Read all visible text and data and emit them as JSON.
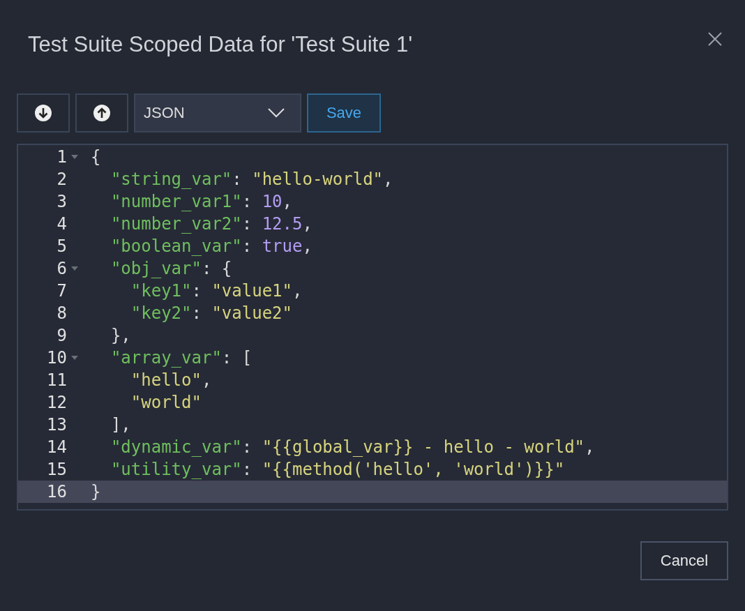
{
  "dialog": {
    "title": "Test Suite Scoped Data for 'Test Suite 1'"
  },
  "toolbar": {
    "format_select": {
      "value": "JSON"
    },
    "save_button": "Save"
  },
  "editor": {
    "lines": [
      {
        "number": "1",
        "foldable": true,
        "active": false,
        "tokens": [
          {
            "kind": "punct",
            "text": "{"
          }
        ]
      },
      {
        "number": "2",
        "foldable": false,
        "active": false,
        "tokens": [
          {
            "kind": "key",
            "text": "  \"string_var\""
          },
          {
            "kind": "punct",
            "text": ": "
          },
          {
            "kind": "string",
            "text": "\"hello-world\""
          },
          {
            "kind": "punct",
            "text": ","
          }
        ]
      },
      {
        "number": "3",
        "foldable": false,
        "active": false,
        "tokens": [
          {
            "kind": "key",
            "text": "  \"number_var1\""
          },
          {
            "kind": "punct",
            "text": ": "
          },
          {
            "kind": "number",
            "text": "10"
          },
          {
            "kind": "punct",
            "text": ","
          }
        ]
      },
      {
        "number": "4",
        "foldable": false,
        "active": false,
        "tokens": [
          {
            "kind": "key",
            "text": "  \"number_var2\""
          },
          {
            "kind": "punct",
            "text": ": "
          },
          {
            "kind": "number",
            "text": "12.5"
          },
          {
            "kind": "punct",
            "text": ","
          }
        ]
      },
      {
        "number": "5",
        "foldable": false,
        "active": false,
        "tokens": [
          {
            "kind": "key",
            "text": "  \"boolean_var\""
          },
          {
            "kind": "punct",
            "text": ": "
          },
          {
            "kind": "number",
            "text": "true"
          },
          {
            "kind": "punct",
            "text": ","
          }
        ]
      },
      {
        "number": "6",
        "foldable": true,
        "active": false,
        "tokens": [
          {
            "kind": "key",
            "text": "  \"obj_var\""
          },
          {
            "kind": "punct",
            "text": ": {"
          }
        ]
      },
      {
        "number": "7",
        "foldable": false,
        "active": false,
        "tokens": [
          {
            "kind": "key",
            "text": "    \"key1\""
          },
          {
            "kind": "punct",
            "text": ": "
          },
          {
            "kind": "string",
            "text": "\"value1\""
          },
          {
            "kind": "punct",
            "text": ","
          }
        ]
      },
      {
        "number": "8",
        "foldable": false,
        "active": false,
        "tokens": [
          {
            "kind": "key",
            "text": "    \"key2\""
          },
          {
            "kind": "punct",
            "text": ": "
          },
          {
            "kind": "string",
            "text": "\"value2\""
          }
        ]
      },
      {
        "number": "9",
        "foldable": false,
        "active": false,
        "tokens": [
          {
            "kind": "punct",
            "text": "  },"
          }
        ]
      },
      {
        "number": "10",
        "foldable": true,
        "active": false,
        "tokens": [
          {
            "kind": "key",
            "text": "  \"array_var\""
          },
          {
            "kind": "punct",
            "text": ": ["
          }
        ]
      },
      {
        "number": "11",
        "foldable": false,
        "active": false,
        "tokens": [
          {
            "kind": "string",
            "text": "    \"hello\""
          },
          {
            "kind": "punct",
            "text": ","
          }
        ]
      },
      {
        "number": "12",
        "foldable": false,
        "active": false,
        "tokens": [
          {
            "kind": "string",
            "text": "    \"world\""
          }
        ]
      },
      {
        "number": "13",
        "foldable": false,
        "active": false,
        "tokens": [
          {
            "kind": "punct",
            "text": "  ],"
          }
        ]
      },
      {
        "number": "14",
        "foldable": false,
        "active": false,
        "tokens": [
          {
            "kind": "key",
            "text": "  \"dynamic_var\""
          },
          {
            "kind": "punct",
            "text": ": "
          },
          {
            "kind": "string",
            "text": "\"{{global_var}} - hello - world\""
          },
          {
            "kind": "punct",
            "text": ","
          }
        ]
      },
      {
        "number": "15",
        "foldable": false,
        "active": false,
        "tokens": [
          {
            "kind": "key",
            "text": "  \"utility_var\""
          },
          {
            "kind": "punct",
            "text": ": "
          },
          {
            "kind": "string",
            "text": "\"{{method('hello', 'world')}}\""
          }
        ]
      },
      {
        "number": "16",
        "foldable": false,
        "active": true,
        "tokens": [
          {
            "kind": "punct",
            "text": "}"
          }
        ]
      }
    ]
  },
  "cancel_button": "Cancel"
}
